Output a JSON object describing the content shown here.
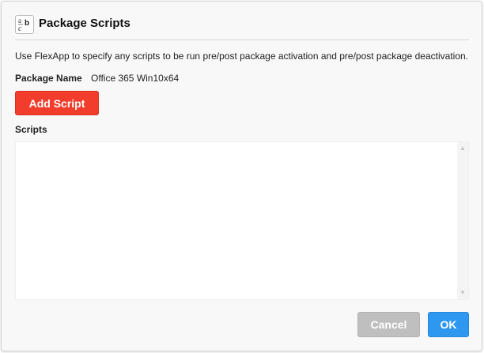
{
  "dialog": {
    "title": "Package Scripts",
    "title_icon": "text-abc-icon",
    "description": "Use FlexApp to specify any scripts to be run pre/post package activation and pre/post package deactivation.",
    "package_name_label": "Package Name",
    "package_name_value": "Office 365 Win10x64",
    "add_script_label": "Add Script",
    "scripts_label": "Scripts",
    "scripts": [],
    "cancel_label": "Cancel",
    "ok_label": "OK"
  },
  "colors": {
    "add_button": "#f23c2c",
    "ok_button": "#2e98f0",
    "cancel_button": "#bfbfbf",
    "dialog_background": "#f8f8f8"
  }
}
